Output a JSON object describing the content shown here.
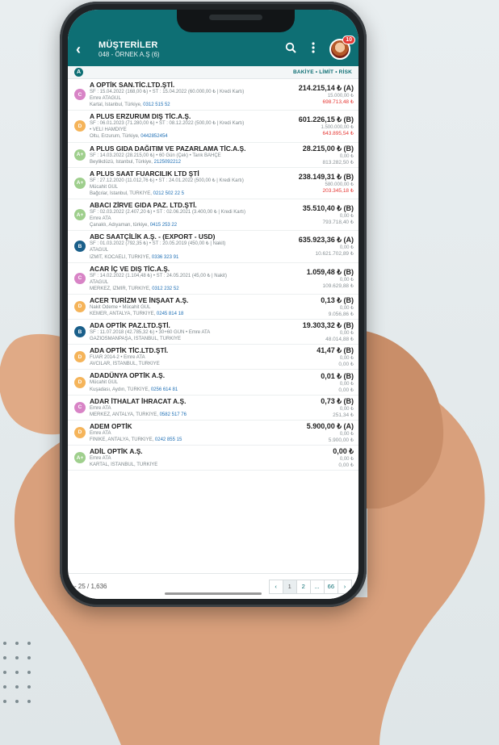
{
  "appbar": {
    "title": "MÜŞTERİLER",
    "subtitle": "048 - ÖRNEK A.Ş (6)",
    "notification_count": "10"
  },
  "section": {
    "letter": "A",
    "header": "BAKİYE • LİMİT • RİSK"
  },
  "rows": [
    {
      "badge": "C",
      "badge_color": "#d884c6",
      "name": "A OPTİK SAN.TİC.LTD.ŞTİ.",
      "line1": "SF : 15.04.2022 (168,00 ₺)  •  ST : 15.04.2022 (60.000,00 ₺ | Kredi Kartı)",
      "line2": "Emre ATAGÜL",
      "line3": "Kartal, İstanbul, Türkiye,",
      "phone": "0312 515 52",
      "balance": "214.215,14 ₺ (A)",
      "limit": "15.000,00 ₺",
      "risk": "698.713,48 ₺",
      "risk_red": true
    },
    {
      "badge": "D",
      "badge_color": "#f5b45a",
      "name": "A PLUS ERZURUM DIŞ TİC.A.Ş.",
      "line1": "SF : 06.01.2023 (71.280,00 ₺)  •  ST : 08.12.2022 (500,00 ₺ | Kredi Kartı)",
      "line2": "•  VELİ HAMDİYE",
      "line3": "Oltu, Erzurum, Türkiye,",
      "phone": "0442852454",
      "balance": "601.226,15 ₺ (B)",
      "limit": "1.500.000,00 ₺",
      "risk": "643.895,54 ₺",
      "risk_red": true
    },
    {
      "badge": "A+",
      "badge_color": "#9fcf8d",
      "name": "A PLUS GIDA DAĞITIM VE PAZARLAMA TİC.A.Ş.",
      "line1": "SF : 14.03.2022 (28.215,00 ₺)  •  60 Gün (Çek)  •  Tarık BAHÇE",
      "line2": "",
      "line3": "Beylikdüzü, İstanbul, Türkiye,",
      "phone": "2125092212",
      "balance": "28.215,00 ₺ (B)",
      "limit": "0,00 ₺",
      "risk": "813.282,50 ₺",
      "risk_red": false
    },
    {
      "badge": "A+",
      "badge_color": "#9fcf8d",
      "name": "A PLUS SAAT FUARCILIK LTD ŞTİ",
      "line1": "SF : 27.12.2020 (11.012,76 ₺)  •  ST : 24.01.2022 (500,00 ₺ | Kredi Kartı)",
      "line2": "Mücahit GÜL",
      "line3": "Bağcılar, İstanbul, TÜRKİYE,",
      "phone": "0212 502 22 5",
      "balance": "238.149,31 ₺ (B)",
      "limit": "580.000,00 ₺",
      "risk": "203.345,18 ₺",
      "risk_red": true
    },
    {
      "badge": "A+",
      "badge_color": "#9fcf8d",
      "name": "ABACI ZİRVE GIDA PAZ. LTD.ŞTİ.",
      "line1": "SF : 02.03.2022 (2.407,20 ₺)  •  ST : 02.06.2021 (3.400,00 ₺ | Kredi Kartı)",
      "line2": "Emre ATA",
      "line3": "Çanaklı, Adıyaman, türkiye,",
      "phone": "0415 253 22",
      "balance": "35.510,40 ₺ (B)",
      "limit": "0,00 ₺",
      "risk": "793.718,40 ₺",
      "risk_red": false
    },
    {
      "badge": "B",
      "badge_color": "#1a5f8a",
      "name": "ABC SAATÇİLİK A.Ş. - (EXPORT - USD)",
      "line1": "SF : 01.03.2022 (792,35 ₺)  •  ST : 20.05.2019 (450,00 ₺ | Nakit)",
      "line2": "ATAGÜL",
      "line3": "İZMİT, KOCAELİ, TÜRKİYE,",
      "phone": "0336 323 91",
      "balance": "635.923,36 ₺ (A)",
      "limit": "0,00 ₺",
      "risk": "10.621.702,89 ₺",
      "risk_red": false
    },
    {
      "badge": "C",
      "badge_color": "#d884c6",
      "name": "ACAR İÇ VE DIŞ TİC.A.Ş.",
      "line1": "SF : 14.02.2022 (1.104,48 ₺)  •  ST : 24.05.2021 (45,00 ₺ | Nakit)",
      "line2": "ATAGÜL",
      "line3": "MERKEZ, İZMİR, TÜRKİYE,",
      "phone": "0312 232 52",
      "balance": "1.059,48 ₺ (B)",
      "limit": "0,00 ₺",
      "risk": "109.629,88 ₺",
      "risk_red": false
    },
    {
      "badge": "D",
      "badge_color": "#f5b45a",
      "name": "ACER TURİZM VE İNŞAAT A.Ş.",
      "line1": "Nakit Ödeme  •  Mücahit GÜL",
      "line2": "",
      "line3": "KEMER, ANTALYA, TÜRKİYE,",
      "phone": "0245 814 18",
      "balance": "0,13 ₺ (B)",
      "limit": "0,00 ₺",
      "risk": "9.056,86 ₺",
      "risk_red": false
    },
    {
      "badge": "B",
      "badge_color": "#1a5f8a",
      "name": "ADA OPTİK PAZ.LTD.ŞTİ.",
      "line1": "SF : 11.07.2018 (42.785,32 ₺)  •  30+60 GÜN  •  Emre ATA",
      "line2": "",
      "line3": "GAZİOSMANPAŞA, İSTANBUL, TÜRKİYE",
      "phone": "",
      "balance": "19.303,32 ₺ (B)",
      "limit": "0,00 ₺",
      "risk": "48.014,88 ₺",
      "risk_red": false
    },
    {
      "badge": "D",
      "badge_color": "#f5b45a",
      "name": "ADA OPTİK TİC.LTD.ŞTİ.",
      "line1": "FUAR 2014-2  •  Emre ATA",
      "line2": "",
      "line3": "AVCILAR, İSTANBUL, TÜRKİYE",
      "phone": "",
      "balance": "41,47 ₺ (B)",
      "limit": "0,00 ₺",
      "risk": "0,00 ₺",
      "risk_red": false
    },
    {
      "badge": "D",
      "badge_color": "#f5b45a",
      "name": "ADADÜNYA OPTİK A.Ş.",
      "line1": "Mücahit GÜL",
      "line2": "",
      "line3": "Kuşadası, Aydın, TÜRKİYE,",
      "phone": "0256 614 81",
      "balance": "0,01 ₺ (B)",
      "limit": "0,00 ₺",
      "risk": "0,00 ₺",
      "risk_red": false
    },
    {
      "badge": "C",
      "badge_color": "#d884c6",
      "name": "ADAR İTHALAT İHRACAT A.Ş.",
      "line1": "Emre ATA",
      "line2": "",
      "line3": "MERKEZ, ANTALYA, TÜRKİYE,",
      "phone": "0582 517 76",
      "balance": "0,73 ₺ (B)",
      "limit": "0,00 ₺",
      "risk": "251,34 ₺",
      "risk_red": false
    },
    {
      "badge": "D",
      "badge_color": "#f5b45a",
      "name": "ADEM OPTİK",
      "line1": "Emre ATA",
      "line2": "",
      "line3": "FİNİKE, ANTALYA, TÜRKİYE,",
      "phone": "0242 855 15",
      "balance": "5.900,00 ₺ (A)",
      "limit": "0,00 ₺",
      "risk": "5.900,00 ₺",
      "risk_red": false
    },
    {
      "badge": "A+",
      "badge_color": "#9fcf8d",
      "name": "ADİL OPTİK A.Ş.",
      "line1": "Emre ATA",
      "line2": "",
      "line3": "KARTAL, İSTANBUL, TÜRKİYE",
      "phone": "",
      "balance": "0,00 ₺",
      "limit": "0,00 ₺",
      "risk": "0,00 ₺",
      "risk_red": false
    }
  ],
  "footer": {
    "count": "- 25 / 1,636",
    "pages": [
      "1",
      "2",
      "...",
      "66"
    ],
    "prev": "‹",
    "next": "›"
  },
  "colors": {
    "primary": "#0e6f74",
    "risk_red": "#e53935",
    "link": "#1e6fb5"
  }
}
